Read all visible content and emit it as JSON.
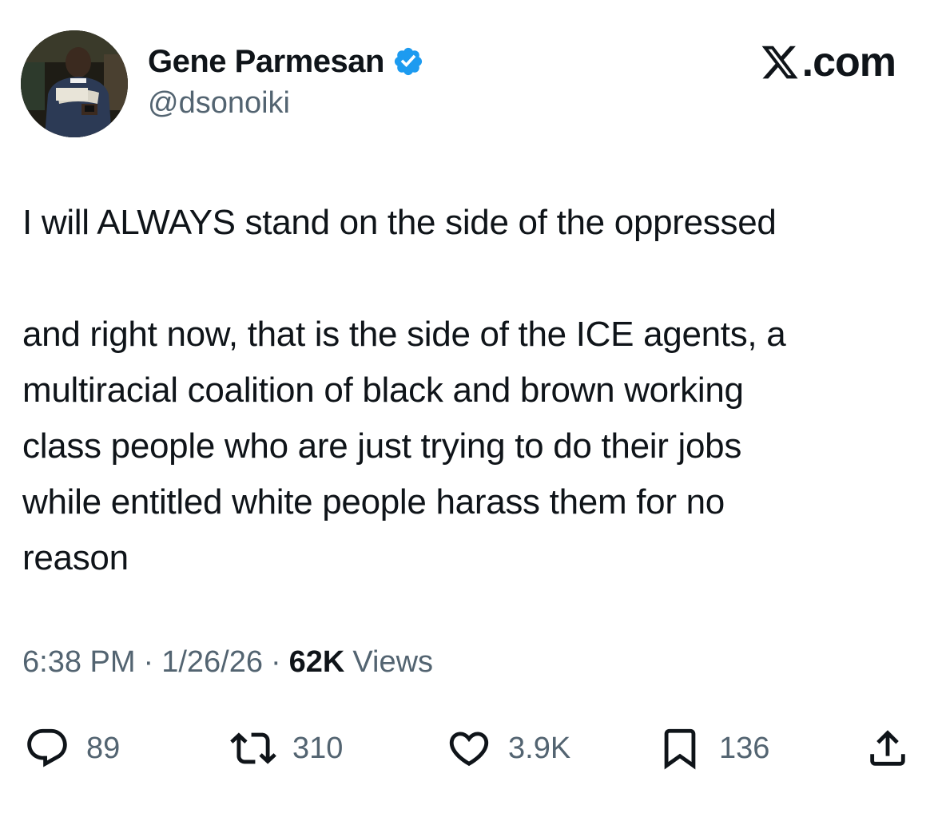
{
  "author": {
    "name": "Gene Parmesan",
    "handle": "@dsonoiki",
    "verified": true
  },
  "site": {
    "logo_text": ".com"
  },
  "tweet": {
    "paragraph_1": "I will ALWAYS stand on the side of the oppressed",
    "paragraph_2": "and right now, that is the side of the ICE agents, a\nmultiracial coalition of black and brown working\nclass people who are just trying to do their jobs\nwhile entitled white people harass them for no\nreason"
  },
  "meta": {
    "time": "6:38 PM",
    "separator": "·",
    "date": "1/26/26",
    "views_count": "62K",
    "views_label": "Views"
  },
  "actions": {
    "reply_count": "89",
    "repost_count": "310",
    "like_count": "3.9K",
    "bookmark_count": "136"
  },
  "icons": {
    "verified": "verified-badge-icon",
    "logo": "x-logo-icon",
    "reply": "reply-icon",
    "repost": "repost-icon",
    "like": "heart-icon",
    "bookmark": "bookmark-icon",
    "share": "share-icon"
  },
  "colors": {
    "text": "#0f1419",
    "secondary": "#536471",
    "verified_blue": "#1d9bf0"
  }
}
